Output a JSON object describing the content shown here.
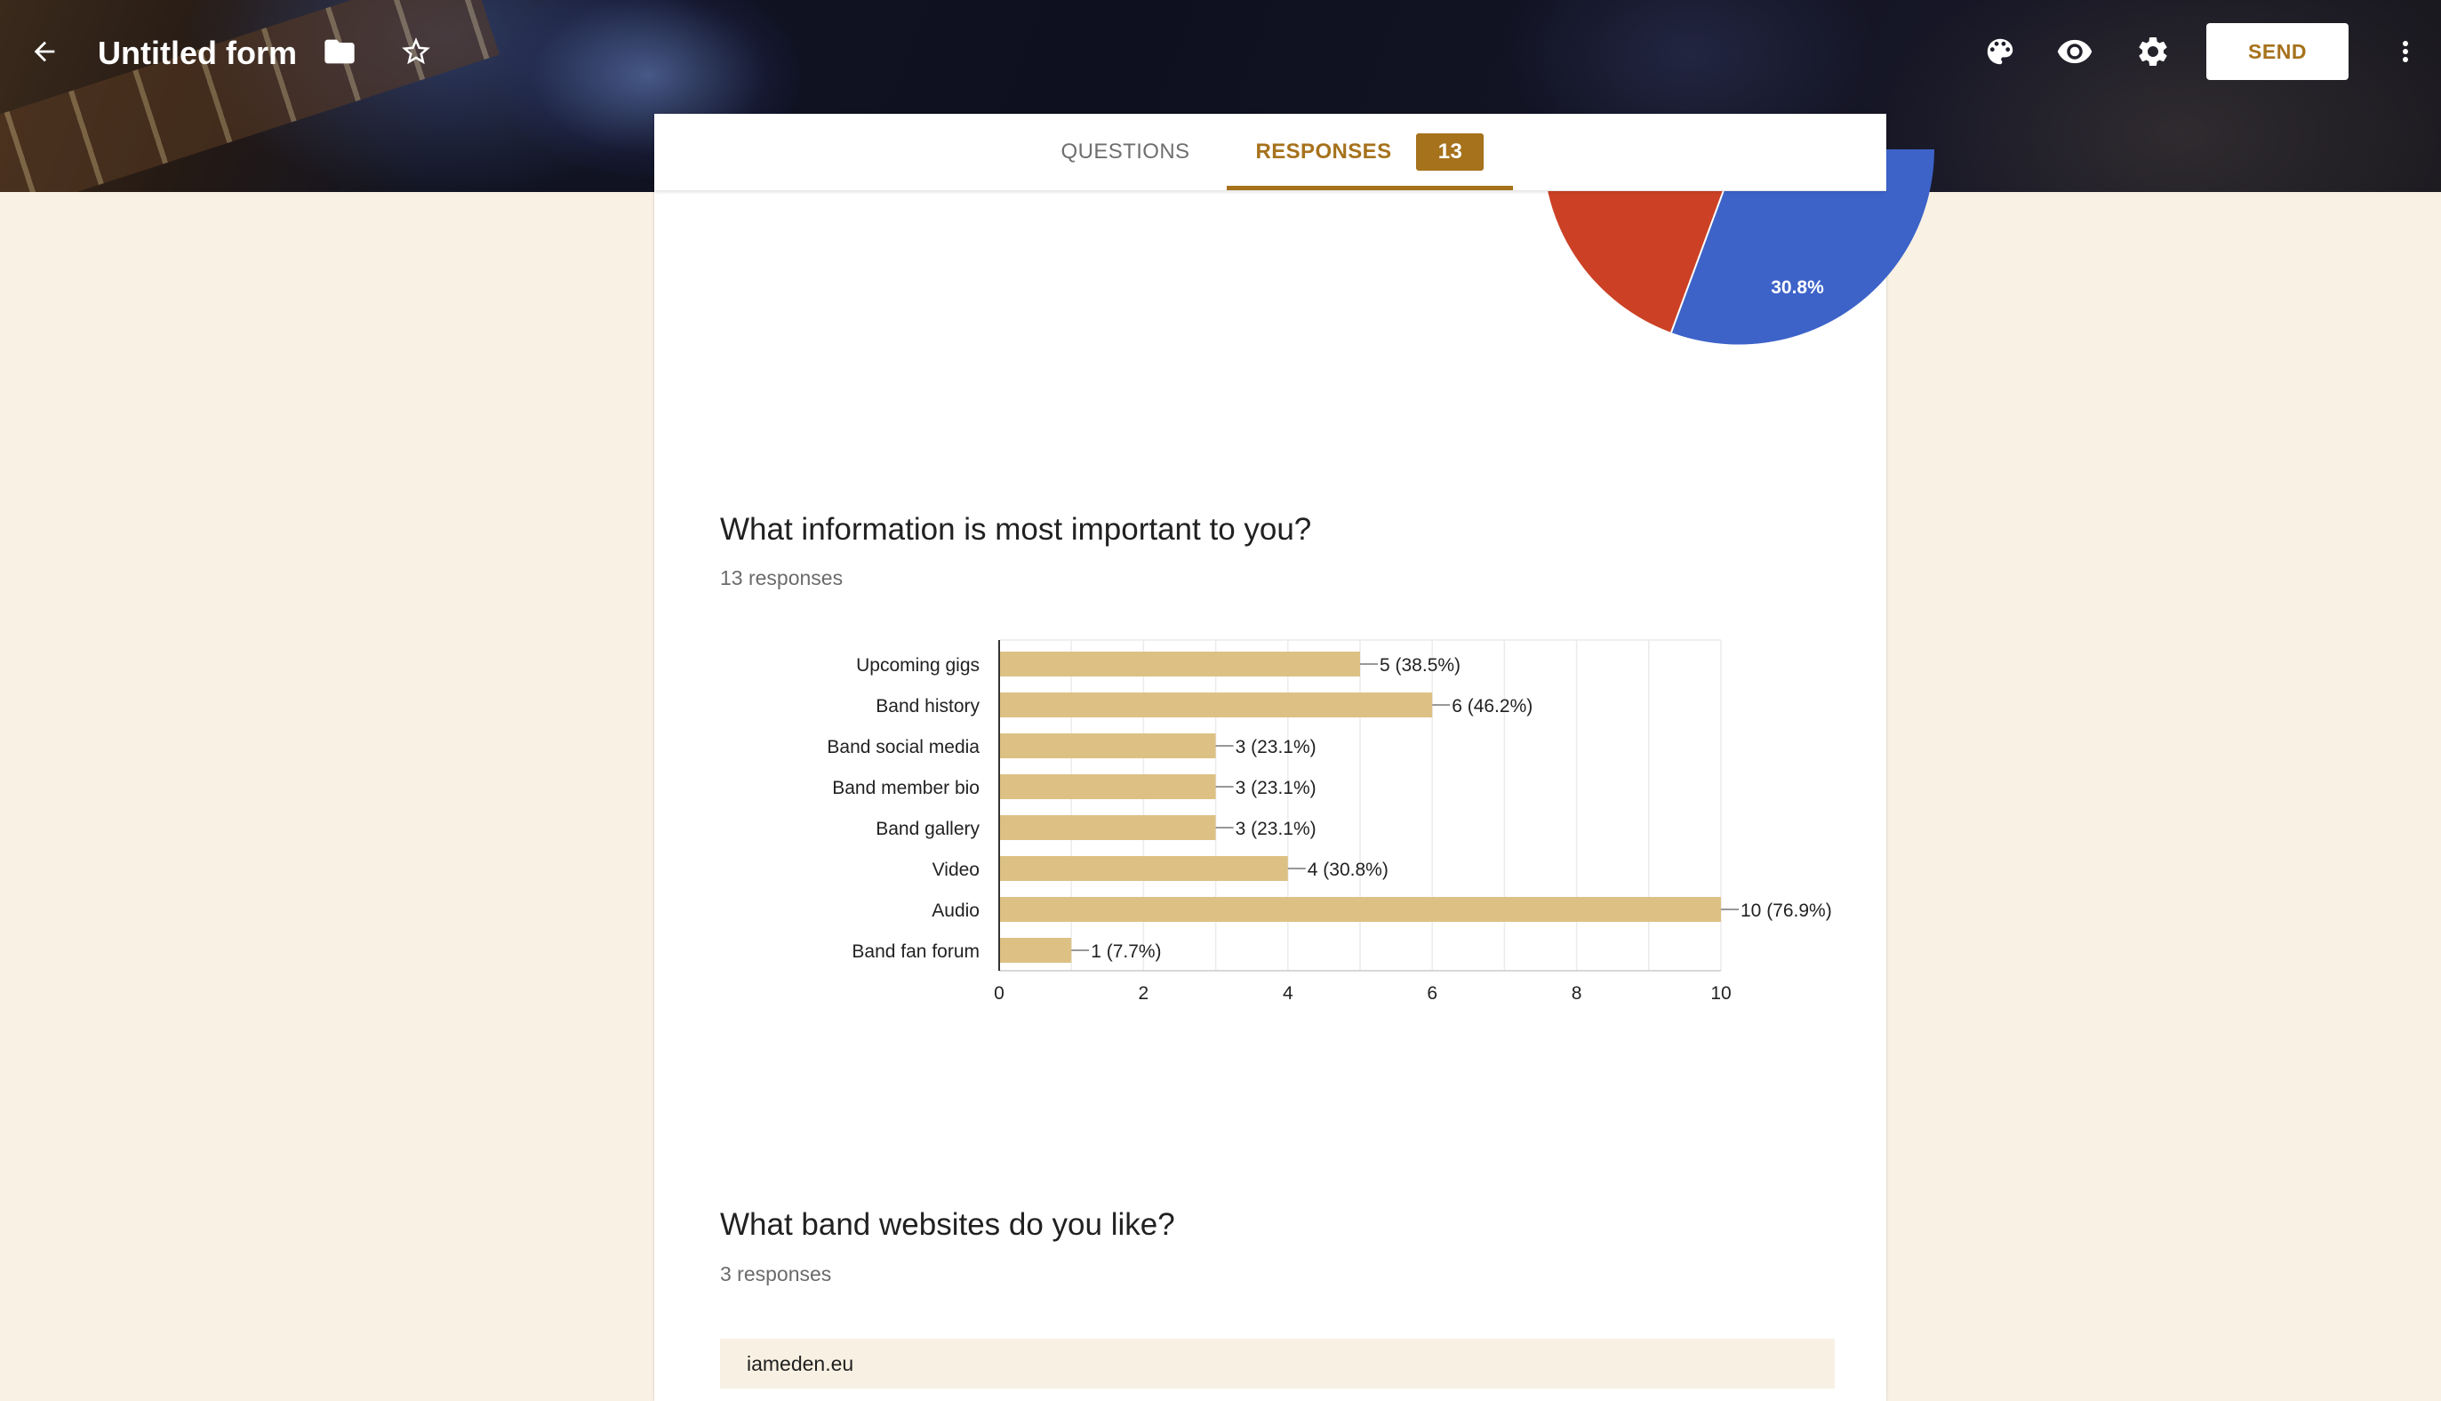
{
  "header": {
    "form_title": "Untitled form",
    "send_label": "SEND",
    "icons": [
      "back-arrow-icon",
      "folder-icon",
      "star-outline-icon",
      "palette-icon",
      "eye-icon",
      "gear-icon",
      "more-vert-icon"
    ]
  },
  "tabs": {
    "questions_label": "QUESTIONS",
    "responses_label": "RESPONSES",
    "responses_count": "13"
  },
  "pie_fragment": {
    "visible_label": "30.8%",
    "colors": [
      "#cc4125",
      "#3d63c9"
    ]
  },
  "question1": {
    "title": "What information is most important to you?",
    "responses": "13 responses"
  },
  "chart_data": {
    "type": "bar",
    "orientation": "horizontal",
    "categories": [
      "Upcoming gigs",
      "Band history",
      "Band social media",
      "Band member bio",
      "Band gallery",
      "Video",
      "Audio",
      "Band fan forum"
    ],
    "values": [
      5,
      6,
      3,
      3,
      3,
      4,
      10,
      1
    ],
    "data_labels": [
      "5 (38.5%)",
      "6 (46.2%)",
      "3 (23.1%)",
      "3 (23.1%)",
      "3 (23.1%)",
      "4 (30.8%)",
      "10 (76.9%)",
      "1 (7.7%)"
    ],
    "xticks": [
      "0",
      "2",
      "4",
      "6",
      "8",
      "10"
    ],
    "xlim": [
      0,
      10
    ],
    "bar_color": "#ddc184",
    "grid": true
  },
  "question2": {
    "title": "What band websites do you like?",
    "responses": "3 responses",
    "answers": [
      "iameden.eu"
    ]
  }
}
